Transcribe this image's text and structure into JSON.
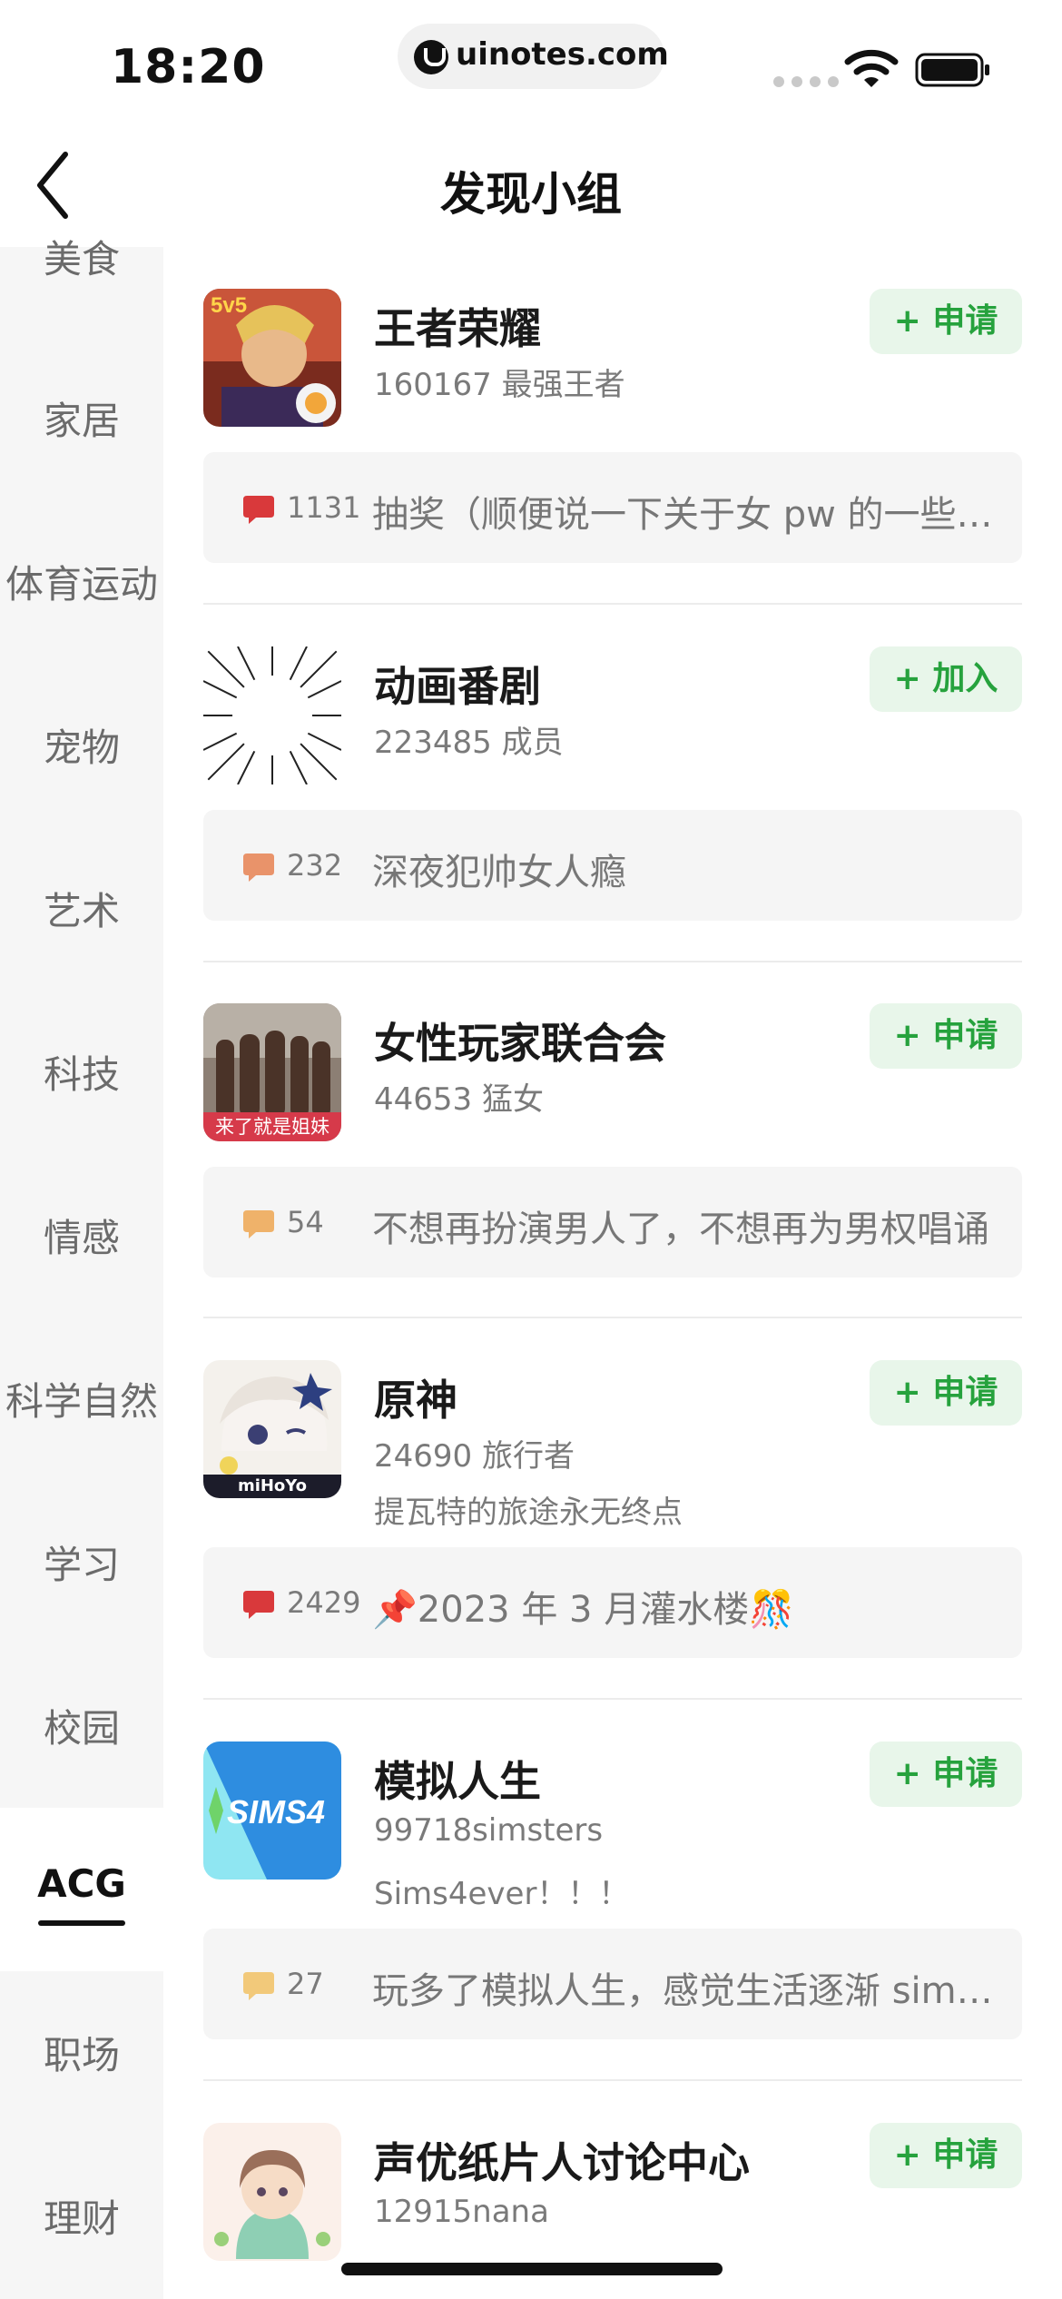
{
  "status": {
    "time": "18:20",
    "url": "uinotes.com"
  },
  "nav": {
    "title": "发现小组"
  },
  "sidebar": {
    "items": [
      {
        "label": "美食"
      },
      {
        "label": "家居"
      },
      {
        "label": "体育运动"
      },
      {
        "label": "宠物"
      },
      {
        "label": "艺术"
      },
      {
        "label": "科技"
      },
      {
        "label": "情感"
      },
      {
        "label": "科学自然"
      },
      {
        "label": "学习"
      },
      {
        "label": "校园"
      },
      {
        "label": "ACG",
        "active": true
      },
      {
        "label": "职场"
      },
      {
        "label": "理财"
      }
    ]
  },
  "groups": [
    {
      "name": "王者荣耀",
      "meta": "160167 最强王者",
      "button": "+ 申请",
      "post": {
        "count": "1131",
        "title": "抽奖（顺便说一下关于女 pw 的一些…",
        "bubble_color": "#d9393b"
      },
      "avatar_overlay": "5v5"
    },
    {
      "name": "动画番剧",
      "meta": "223485 成员",
      "button": "+ 加入",
      "post": {
        "count": "232",
        "title": "深夜犯帅女人瘾",
        "bubble_color": "#e9936a"
      }
    },
    {
      "name": "女性玩家联合会",
      "meta": "44653 猛女",
      "button": "+ 申请",
      "post": {
        "count": "54",
        "title": "不想再扮演男人了，不想再为男权唱诵",
        "bubble_color": "#efb26a"
      },
      "avatar_caption": "来了就是姐妹"
    },
    {
      "name": "原神",
      "meta": "24690 旅行者",
      "desc": "提瓦特的旅途永无终点",
      "button": "+ 申请",
      "post": {
        "count": "2429",
        "title": "📌2023 年 3 月灌水楼🎊",
        "bubble_color": "#d9393b"
      },
      "avatar_caption": "miHoYo"
    },
    {
      "name": "模拟人生",
      "meta": "99718simsters",
      "desc": "Sims4ever！！！",
      "button": "+ 申请",
      "post": {
        "count": "27",
        "title": "玩多了模拟人生，感觉生活逐渐 sim…",
        "bubble_color": "#f2c97a"
      },
      "avatar_overlay": "SIMS4"
    },
    {
      "name": "声优纸片人讨论中心",
      "meta": "12915nana",
      "button": "+ 申请"
    }
  ],
  "colors": {
    "accent_green": "#26a23d",
    "button_bg": "#e8f6ea",
    "sidebar_bg": "#f6f6f6"
  }
}
